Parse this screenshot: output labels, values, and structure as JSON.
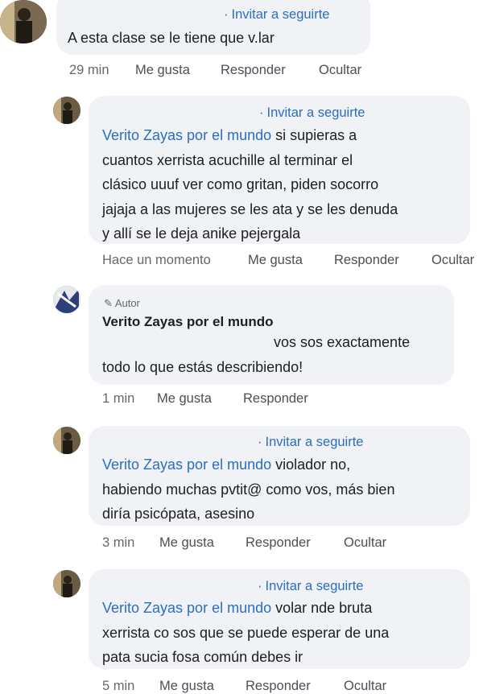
{
  "comments": [
    {
      "invite": "Invitar a seguirte",
      "mention": "",
      "lines": [
        "A esta clase se le tiene que v.lar"
      ],
      "time": "29 min",
      "like": "Me gusta",
      "reply": "Responder",
      "hide": "Ocultar"
    },
    {
      "invite": "Invitar a seguirte",
      "mention": "Verito Zayas por el mundo",
      "first_rest": " si supieras a",
      "lines": [
        "cuantos xerrista acuchille al terminar el",
        "clásico uuuf ver como gritan, piden socorro",
        "jajaja a las mujeres se les ata y se les denuda",
        "y allí se le deja anike pejergala"
      ],
      "time": "Hace un momento",
      "like": "Me gusta",
      "reply": "Responder",
      "hide": "Ocultar"
    },
    {
      "badge": "Autor",
      "author": "Verito Zayas por el mundo",
      "lines": [
        "vos sos exactamente",
        "todo lo que estás describiendo!"
      ],
      "time": "1 min",
      "like": "Me gusta",
      "reply": "Responder"
    },
    {
      "invite": "Invitar a seguirte",
      "mention": "Verito Zayas por el mundo",
      "first_rest": " violador no,",
      "lines": [
        "habiendo muchas pvtit@ como vos, más bien",
        "diría psicópata, asesino"
      ],
      "time": "3 min",
      "like": "Me gusta",
      "reply": "Responder",
      "hide": "Ocultar"
    },
    {
      "invite": "Invitar a seguirte",
      "mention": "Verito Zayas por el mundo",
      "first_rest": " volar nde bruta",
      "lines": [
        "xerrista co sos que se puede esperar de una",
        "pata sucia fosa común debes ir"
      ],
      "time": "5 min",
      "like": "Me gusta",
      "reply": "Responder",
      "hide": "Ocultar"
    }
  ],
  "colors": {
    "link": "#2a6fbf",
    "bubble": "#f0f2f5",
    "meta": "#65676b"
  }
}
